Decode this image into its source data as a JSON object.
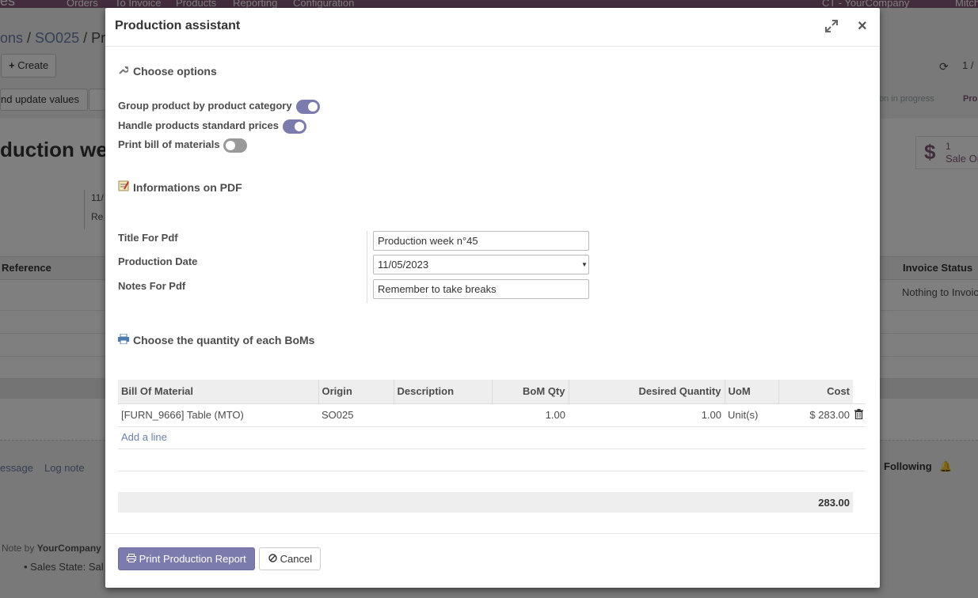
{
  "background": {
    "nav": {
      "brand_fragment": "es",
      "items": [
        "Orders",
        "To Invoice",
        "Products",
        "Reporting",
        "Configuration"
      ],
      "company": "CT - YourCompany",
      "user": "Mitch"
    },
    "breadcrumb": {
      "part1": "ons",
      "sep": " / ",
      "part2": "SO025",
      "part3": " / Pr"
    },
    "create_button": "Create",
    "pager": "1 /",
    "action_button": "nd update values",
    "status_in_progress": "on in progress",
    "status_current": "Pro",
    "record_title": "duction we",
    "stat": {
      "value": "1",
      "label": "Sale Or"
    },
    "field_date": "11/",
    "field_ref": "Re",
    "table": {
      "col_reference": "Reference",
      "col_invoice_status": "Invoice Status",
      "row_invoice_status": "Nothing to Invoic"
    },
    "chatter": {
      "send_message": "essage",
      "log_note": "Log note",
      "following": "Following"
    },
    "note": {
      "prefix": "Note by",
      "author": "YourCompany"
    },
    "sales_state": "Sales State: Sal"
  },
  "modal": {
    "title": "Production assistant",
    "options_section": {
      "title": "Choose options",
      "icon": "wrench-icon",
      "options": [
        {
          "label": "Group product by product category",
          "enabled": true
        },
        {
          "label": "Handle products standard prices",
          "enabled": true
        },
        {
          "label": "Print bill of materials",
          "enabled": false
        }
      ]
    },
    "pdf_section": {
      "title": "Informations on PDF",
      "icon": "notepad-icon",
      "fields": {
        "title_label": "Title For Pdf",
        "title_value": "Production week n°45",
        "date_label": "Production Date",
        "date_value": "11/05/2023",
        "notes_label": "Notes For Pdf",
        "notes_value": "Remember to take breaks"
      }
    },
    "bom_section": {
      "title": "Choose the quantity of each BoMs",
      "icon": "printer-icon",
      "columns": [
        "Bill Of Material",
        "Origin",
        "Description",
        "BoM Qty",
        "Desired Quantity",
        "UoM",
        "Cost"
      ],
      "rows": [
        {
          "bom": "[FURN_9666] Table (MTO)",
          "origin": "SO025",
          "description": "",
          "bom_qty": "1.00",
          "desired_qty": "1.00",
          "uom": "Unit(s)",
          "cost": "$ 283.00"
        }
      ],
      "add_line": "Add a line",
      "total": "283.00"
    },
    "footer": {
      "print_button": "Print Production Report",
      "cancel_button": "Cancel"
    }
  },
  "colors": {
    "brand": "#875a7b",
    "primary_button": "#7c7bad",
    "toggle_on": "#7c7bad",
    "toggle_off": "#999999",
    "link": "#6a7fa8"
  }
}
